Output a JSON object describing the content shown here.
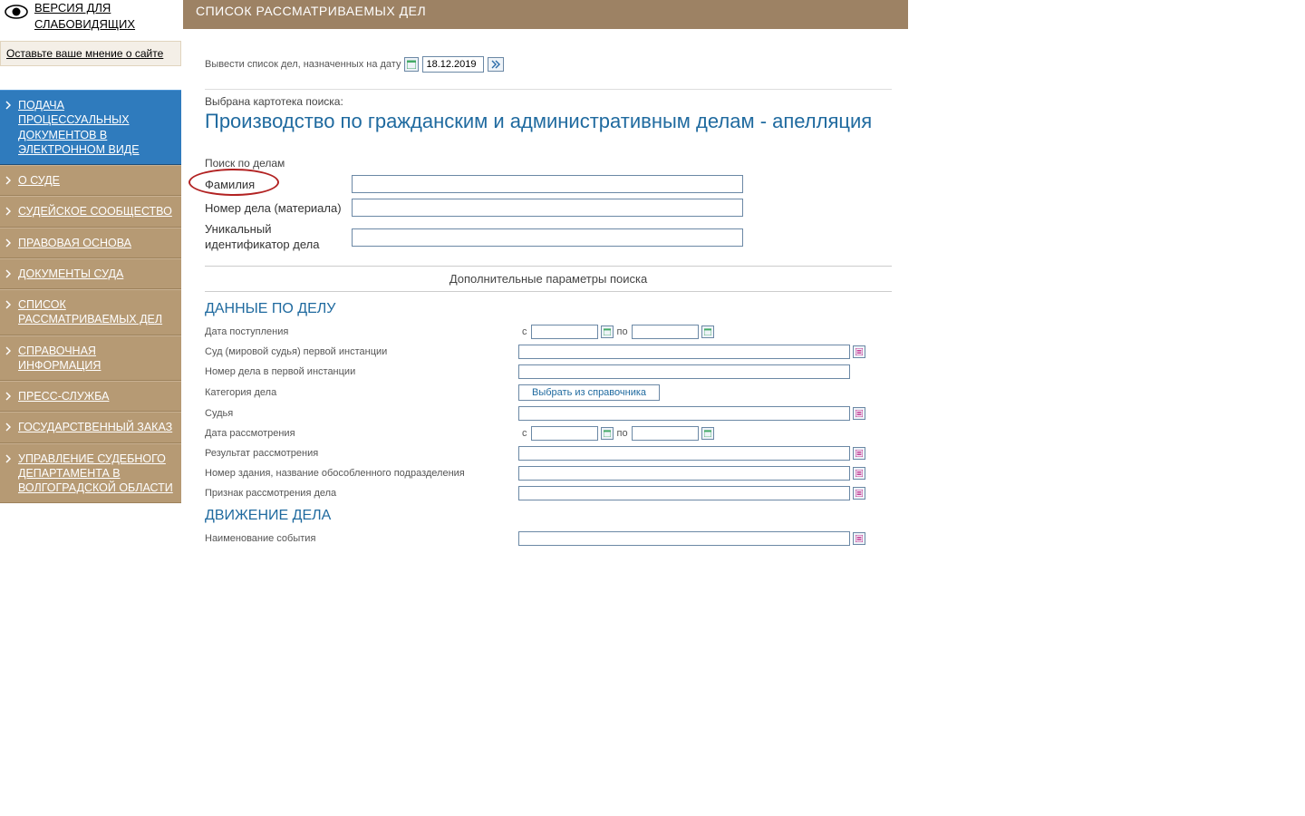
{
  "accessibility": {
    "label": "ВЕРСИЯ ДЛЯ СЛАБОВИДЯЩИХ"
  },
  "feedback": {
    "label": "Оставьте ваше мнение о сайте"
  },
  "nav": {
    "items": [
      {
        "label": "ПОДАЧА ПРОЦЕССУАЛЬНЫХ ДОКУМЕНТОВ В ЭЛЕКТРОННОМ ВИДЕ",
        "highlight": true
      },
      {
        "label": "О СУДЕ"
      },
      {
        "label": "СУДЕЙСКОЕ СООБЩЕСТВО"
      },
      {
        "label": "ПРАВОВАЯ ОСНОВА"
      },
      {
        "label": "ДОКУМЕНТЫ СУДА"
      },
      {
        "label": "СПИСОК РАССМАТРИВАЕМЫХ ДЕЛ"
      },
      {
        "label": "СПРАВОЧНАЯ ИНФОРМАЦИЯ"
      },
      {
        "label": "ПРЕСС-СЛУЖБА"
      },
      {
        "label": "ГОСУДАРСТВЕННЫЙ ЗАКАЗ"
      },
      {
        "label": "УПРАВЛЕНИЕ СУДЕБНОГО ДЕПАРТАМЕНТА В ВОЛГОГРАДСКОЙ ОБЛАСТИ"
      }
    ]
  },
  "page": {
    "title": "СПИСОК РАССМАТРИВАЕМЫХ ДЕЛ"
  },
  "dateLine": {
    "label": "Вывести список дел, назначенных на дату",
    "value": "18.12.2019"
  },
  "carto": {
    "legend": "Выбрана картотека поиска:",
    "title": "Производство по гражданским и административным делам - апелляция"
  },
  "search": {
    "legend": "Поиск по делам",
    "surname_label": "Фамилия",
    "case_no_label": "Номер дела (материала)",
    "uid_label": "Уникальный идентификатор дела",
    "additional_label": "Дополнительные параметры поиска"
  },
  "caseData": {
    "heading": "ДАННЫЕ ПО ДЕЛУ",
    "date_in_label": "Дата поступления",
    "from": "с",
    "to": "по",
    "court_label": "Суд (мировой судья) первой инстанции",
    "first_no_label": "Номер дела в первой инстанции",
    "category_label": "Категория дела",
    "pick_label": "Выбрать из справочника",
    "judge_label": "Судья",
    "hearing_date_label": "Дата рассмотрения",
    "result_label": "Результат рассмотрения",
    "building_label": "Номер здания, название обособленного подразделения",
    "sign_label": "Признак рассмотрения дела"
  },
  "movement": {
    "heading": "ДВИЖЕНИЕ ДЕЛА",
    "event_label": "Наименование события"
  }
}
